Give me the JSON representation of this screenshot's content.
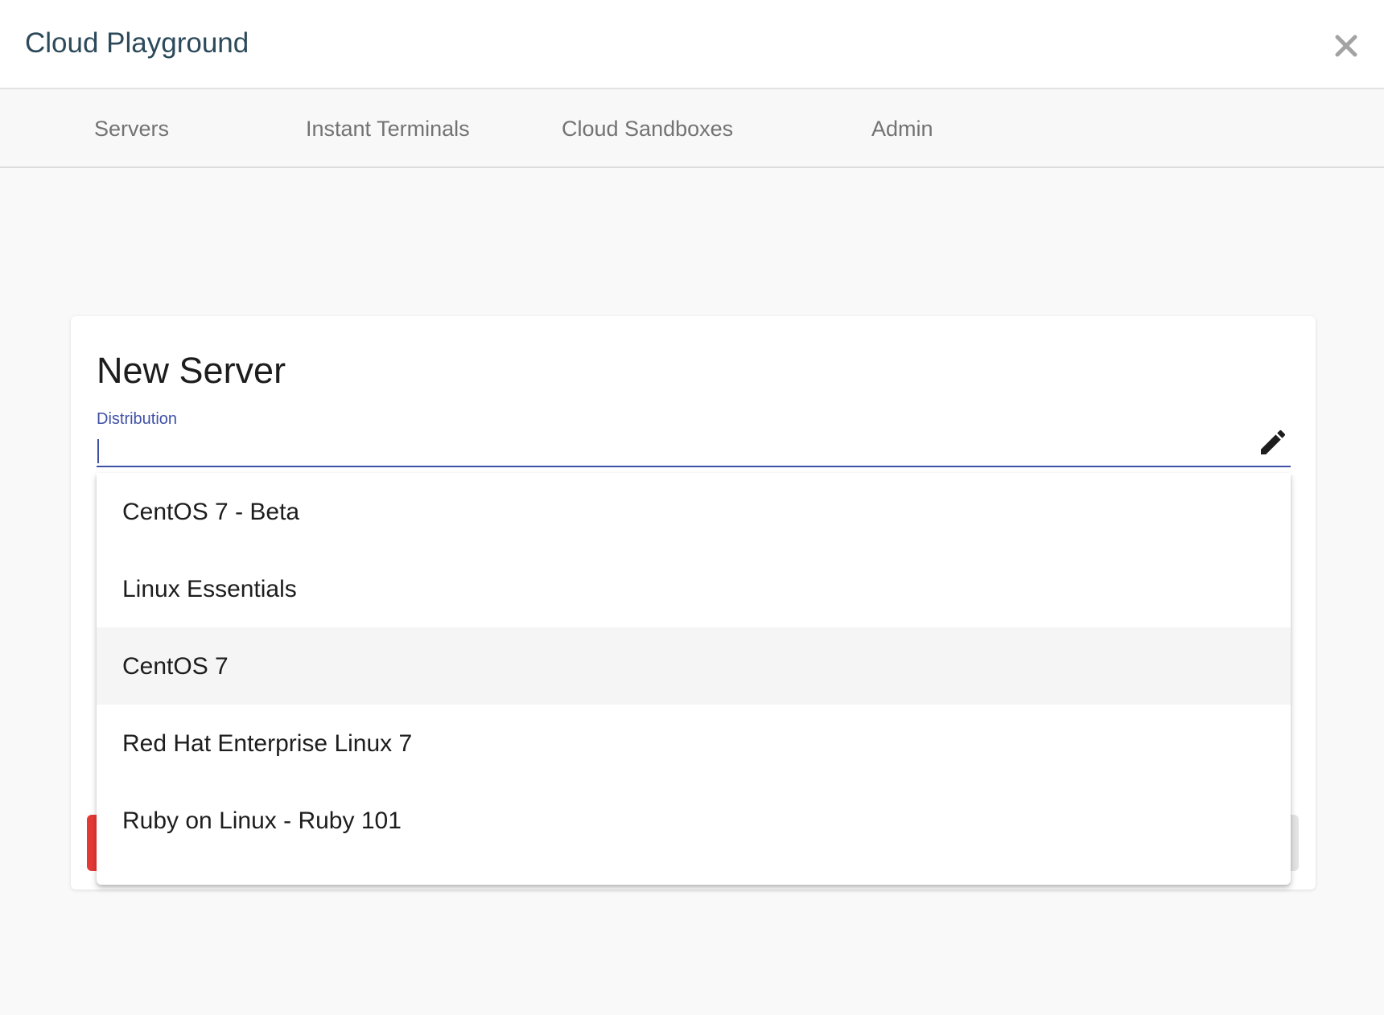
{
  "header": {
    "title": "Cloud Playground",
    "close_icon": "close-icon"
  },
  "nav": {
    "tabs": [
      {
        "label": "Servers"
      },
      {
        "label": "Instant Terminals"
      },
      {
        "label": "Cloud Sandboxes"
      },
      {
        "label": "Admin"
      }
    ]
  },
  "form": {
    "title": "New Server",
    "distribution": {
      "label": "Distribution",
      "value": "",
      "icon": "pencil-icon"
    }
  },
  "dropdown": {
    "hovered_index": 2,
    "options": [
      {
        "label": "CentOS 7 - Beta"
      },
      {
        "label": "Linux Essentials"
      },
      {
        "label": "CentOS 7"
      },
      {
        "label": "Red Hat Enterprise Linux 7"
      },
      {
        "label": "Ruby on Linux - Ruby 101"
      }
    ]
  },
  "colors": {
    "accent": "#3f51a5",
    "danger": "#e53935",
    "title": "#2d4a5a"
  }
}
